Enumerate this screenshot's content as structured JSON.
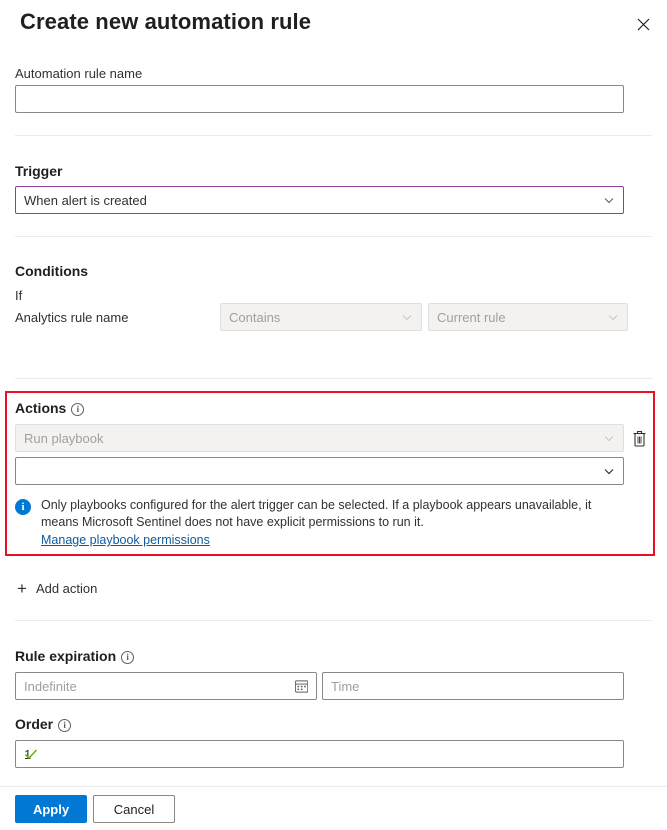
{
  "header": {
    "title": "Create new automation rule",
    "close_icon": "close-icon"
  },
  "name_section": {
    "label": "Automation rule name",
    "value": "",
    "placeholder": ""
  },
  "trigger_section": {
    "label": "Trigger",
    "selected": "When alert is created",
    "chevron_icon": "chevron-down-icon"
  },
  "conditions_section": {
    "label": "Conditions",
    "if_label": "If",
    "property_label": "Analytics rule name",
    "operator": {
      "value": "Contains",
      "disabled": true
    },
    "value_field": {
      "value": "Current rule",
      "disabled": true
    }
  },
  "actions_section": {
    "label": "Actions",
    "info_icon": "info-icon",
    "action_type": {
      "value": "Run playbook",
      "disabled": true
    },
    "playbook_select": {
      "value": "",
      "placeholder": ""
    },
    "delete_icon": "trash-icon",
    "message": {
      "icon": "info-filled-icon",
      "text": "Only playbooks configured for the alert trigger can be selected. If a playbook appears unavailable, it means Microsoft Sentinel does not have explicit permissions to run it.",
      "link": "Manage playbook permissions"
    },
    "highlight_color": "#e81123"
  },
  "add_action": {
    "label": "Add action",
    "plus_icon": "plus-icon"
  },
  "rule_expiration": {
    "label": "Rule expiration",
    "info_icon": "info-icon",
    "date_placeholder": "Indefinite",
    "date_value": "",
    "calendar_icon": "calendar-icon",
    "time_placeholder": "Time",
    "time_value": ""
  },
  "order": {
    "label": "Order",
    "info_icon": "info-icon",
    "value": "1",
    "valid_icon": "checkmark-icon",
    "valid_color": "#6bb700"
  },
  "footer": {
    "apply_label": "Apply",
    "cancel_label": "Cancel",
    "primary_color": "#0078d4"
  }
}
